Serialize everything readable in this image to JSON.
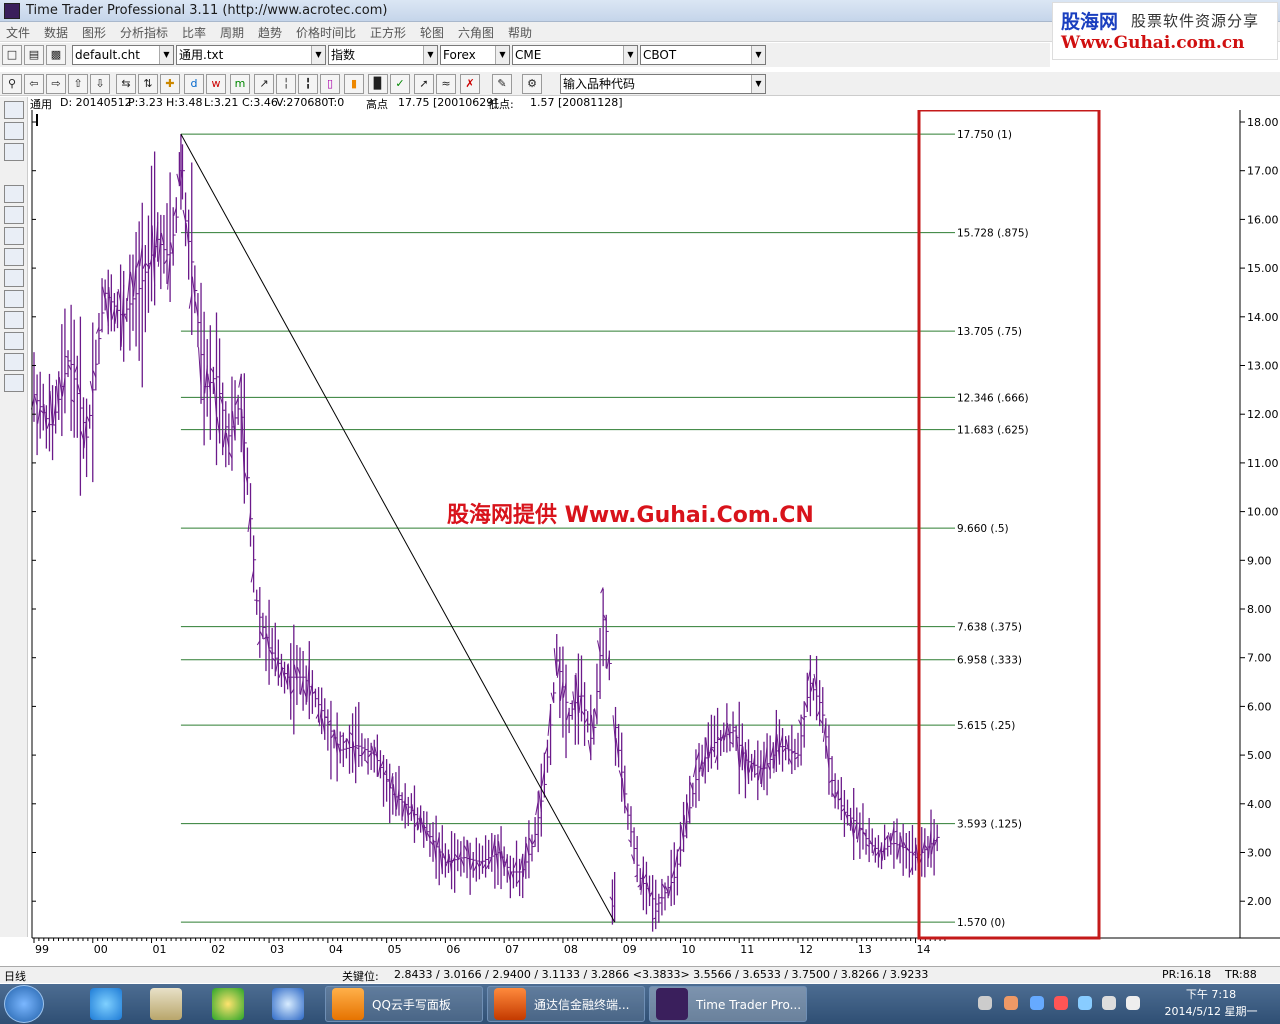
{
  "window": {
    "title": "Time Trader Professional 3.11 (http://www.acrotec.com)"
  },
  "menu": [
    "文件",
    "数据",
    "图形",
    "分析指标",
    "比率",
    "周期",
    "趋势",
    "价格时间比",
    "正方形",
    "轮图",
    "六角图",
    "帮助"
  ],
  "ad": {
    "brand": "股海网",
    "slogan": "股票软件资源分享",
    "url": "Www.Guhai.com.cn"
  },
  "toolbar": {
    "chart_file": "default.cht",
    "data_file": "通用.txt",
    "index": "指数",
    "market1": "Forex",
    "market2": "CME",
    "market3": "CBOT",
    "symbol_input": "输入品种代码"
  },
  "info": {
    "symbol": "通用",
    "date": "D: 20140512",
    "open": "P:3.23",
    "high": "H:3.48",
    "low": "L:3.21",
    "close": "C:3.46",
    "volume": "V:270680",
    "oi": "T:0",
    "high_label": "高点",
    "high_value": "17.75 [20010629]",
    "low_label": "低点:",
    "low_value": "1.57 [20081128]"
  },
  "watermark": "股海网提供 Www.Guhai.Com.CN",
  "chart_data": {
    "type": "bar",
    "subtype": "ohlc",
    "x_labels": [
      "99",
      "00",
      "01",
      "02",
      "03",
      "04",
      "05",
      "06",
      "07",
      "08",
      "09",
      "10",
      "11",
      "12",
      "13",
      "14"
    ],
    "y_ticks": [
      "2.00",
      "3.00",
      "4.00",
      "5.00",
      "6.00",
      "7.00",
      "8.00",
      "9.00",
      "10.00",
      "11.00",
      "12.00",
      "13.00",
      "14.00",
      "15.00",
      "16.00",
      "17.00",
      "18.00"
    ],
    "ylim": [
      1.3,
      18.2
    ],
    "fib_levels": [
      {
        "value": 17.75,
        "label": "17.750 (1)"
      },
      {
        "value": 15.728,
        "label": "15.728 (.875)"
      },
      {
        "value": 13.705,
        "label": "13.705 (.75)"
      },
      {
        "value": 12.346,
        "label": "12.346 (.666)"
      },
      {
        "value": 11.683,
        "label": "11.683 (.625)"
      },
      {
        "value": 9.66,
        "label": "9.660 (.5)"
      },
      {
        "value": 7.638,
        "label": "7.638 (.375)"
      },
      {
        "value": 6.958,
        "label": "6.958 (.333)"
      },
      {
        "value": 5.615,
        "label": "5.615 (.25)"
      },
      {
        "value": 3.593,
        "label": "3.593 (.125)"
      },
      {
        "value": 1.57,
        "label": "1.570 (0)"
      }
    ],
    "trendline": {
      "from": {
        "x": "2001-06",
        "y": 17.75
      },
      "to": {
        "x": "2008-11",
        "y": 1.57
      }
    },
    "price_path": [
      {
        "x": 1999.0,
        "y": 12.4
      },
      {
        "x": 1999.3,
        "y": 11.7
      },
      {
        "x": 1999.6,
        "y": 13.2
      },
      {
        "x": 1999.9,
        "y": 11.5
      },
      {
        "x": 2000.2,
        "y": 14.5
      },
      {
        "x": 2000.5,
        "y": 14.0
      },
      {
        "x": 2000.8,
        "y": 14.6
      },
      {
        "x": 2001.1,
        "y": 15.6
      },
      {
        "x": 2001.3,
        "y": 15.2
      },
      {
        "x": 2001.5,
        "y": 16.6
      },
      {
        "x": 2001.7,
        "y": 15.0
      },
      {
        "x": 2001.9,
        "y": 12.5
      },
      {
        "x": 2002.1,
        "y": 12.8
      },
      {
        "x": 2002.3,
        "y": 11.5
      },
      {
        "x": 2002.5,
        "y": 12.2
      },
      {
        "x": 2002.6,
        "y": 11.2
      },
      {
        "x": 2002.8,
        "y": 8.0
      },
      {
        "x": 2003.0,
        "y": 7.2
      },
      {
        "x": 2003.3,
        "y": 6.6
      },
      {
        "x": 2003.6,
        "y": 6.6
      },
      {
        "x": 2003.9,
        "y": 5.9
      },
      {
        "x": 2004.2,
        "y": 5.1
      },
      {
        "x": 2004.5,
        "y": 5.2
      },
      {
        "x": 2004.8,
        "y": 5.0
      },
      {
        "x": 2005.1,
        "y": 4.2
      },
      {
        "x": 2005.4,
        "y": 3.9
      },
      {
        "x": 2005.7,
        "y": 3.4
      },
      {
        "x": 2006.0,
        "y": 2.8
      },
      {
        "x": 2006.3,
        "y": 2.9
      },
      {
        "x": 2006.6,
        "y": 2.8
      },
      {
        "x": 2006.9,
        "y": 3.0
      },
      {
        "x": 2007.1,
        "y": 2.6
      },
      {
        "x": 2007.3,
        "y": 2.6
      },
      {
        "x": 2007.5,
        "y": 3.2
      },
      {
        "x": 2007.7,
        "y": 4.5
      },
      {
        "x": 2007.9,
        "y": 7.0
      },
      {
        "x": 2008.1,
        "y": 5.8
      },
      {
        "x": 2008.3,
        "y": 6.3
      },
      {
        "x": 2008.5,
        "y": 5.2
      },
      {
        "x": 2008.7,
        "y": 8.0
      },
      {
        "x": 2008.9,
        "y": 5.5
      },
      {
        "x": 2009.1,
        "y": 3.8
      },
      {
        "x": 2009.3,
        "y": 2.5
      },
      {
        "x": 2009.6,
        "y": 1.9
      },
      {
        "x": 2009.9,
        "y": 2.5
      },
      {
        "x": 2010.1,
        "y": 3.6
      },
      {
        "x": 2010.3,
        "y": 4.7
      },
      {
        "x": 2010.6,
        "y": 5.3
      },
      {
        "x": 2010.9,
        "y": 5.5
      },
      {
        "x": 2011.1,
        "y": 4.9
      },
      {
        "x": 2011.4,
        "y": 4.7
      },
      {
        "x": 2011.7,
        "y": 5.2
      },
      {
        "x": 2012.0,
        "y": 5.0
      },
      {
        "x": 2012.2,
        "y": 6.5
      },
      {
        "x": 2012.4,
        "y": 6.0
      },
      {
        "x": 2012.6,
        "y": 4.3
      },
      {
        "x": 2012.8,
        "y": 3.8
      },
      {
        "x": 2013.0,
        "y": 3.6
      },
      {
        "x": 2013.2,
        "y": 3.2
      },
      {
        "x": 2013.4,
        "y": 3.0
      },
      {
        "x": 2013.6,
        "y": 3.2
      },
      {
        "x": 2013.8,
        "y": 3.1
      },
      {
        "x": 2014.0,
        "y": 2.9
      },
      {
        "x": 2014.2,
        "y": 3.1
      },
      {
        "x": 2014.4,
        "y": 3.35
      }
    ]
  },
  "status": {
    "period": "日线",
    "key_label": "关键位:",
    "key_values": "2.8433 / 3.0166 / 2.9400 / 3.1133 / 3.2866 <3.3833> 3.5566 / 3.6533 / 3.7500 / 3.8266 / 3.9233",
    "pr": "PR:16.18",
    "tr": "TR:88"
  },
  "taskbar": {
    "items": [
      "QQ云手写面板",
      "通达信金融终端...",
      "Time Trader Pro..."
    ],
    "time": "下午 7:18",
    "date": "2014/5/12 星期一"
  },
  "colors": {
    "fib": "#2e7d32",
    "bars": "#6b1a8a",
    "trend": "#000000",
    "highlight": "#c41a1a"
  }
}
